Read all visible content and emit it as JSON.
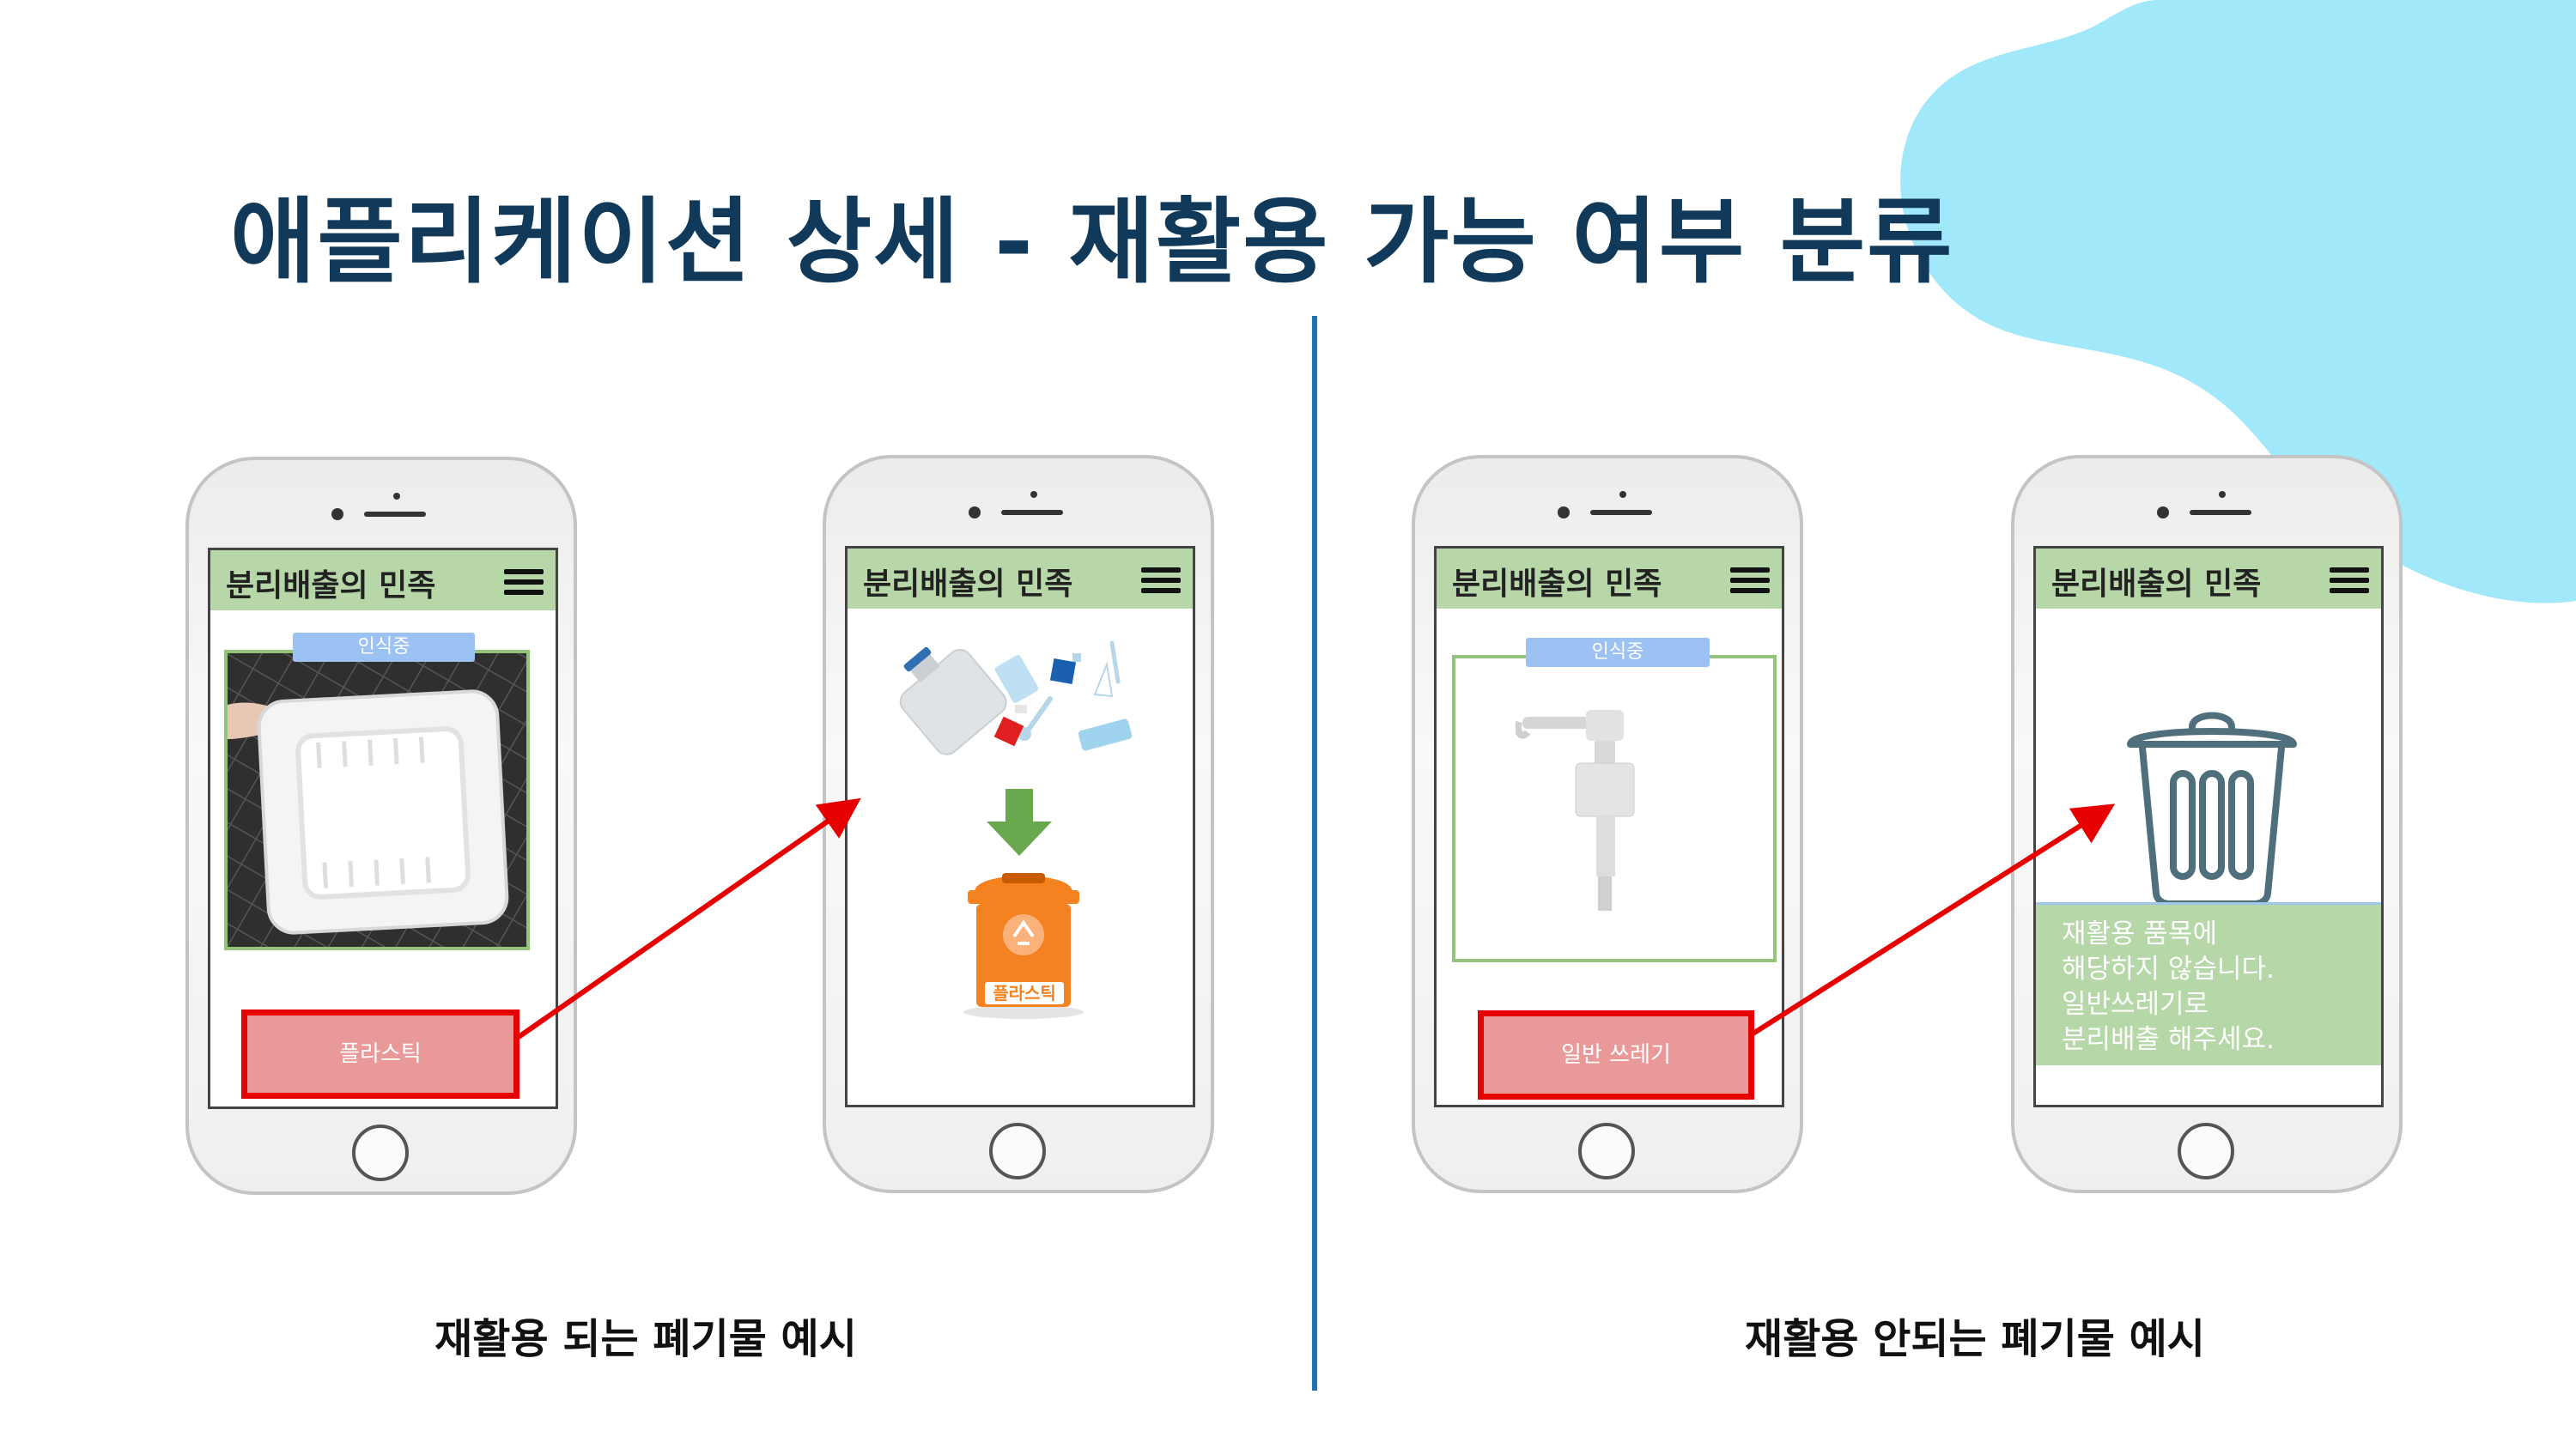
{
  "slide": {
    "title": "애플리케이션 상세 - 재활용 가능 여부 분류",
    "caption_left": "재활용 되는 폐기물 예시",
    "caption_right": "재활용 안되는 폐기물 예시"
  },
  "app": {
    "name": "분리배출의 민족",
    "recognizing_label": "인식중"
  },
  "phone1": {
    "result_button": "플라스틱"
  },
  "phone2": {
    "bin_label": "플라스틱"
  },
  "phone3": {
    "result_button": "일반 쓰레기"
  },
  "phone4": {
    "message_lines": [
      "재활용 품목에",
      "해당하지 않습니다.",
      "일반쓰레기로",
      "분리배출 해주세요."
    ]
  },
  "colors": {
    "title": "#10395a",
    "divider": "#1e73b4",
    "appbar": "#b7d7a8",
    "highlight_border": "#e60000",
    "result_fill": "#ea9999",
    "blob": "#a0e8fa",
    "bin_orange": "#f58220"
  },
  "icons": [
    "menu-icon",
    "recycle-icon",
    "trash-can-icon",
    "down-arrow-icon"
  ]
}
